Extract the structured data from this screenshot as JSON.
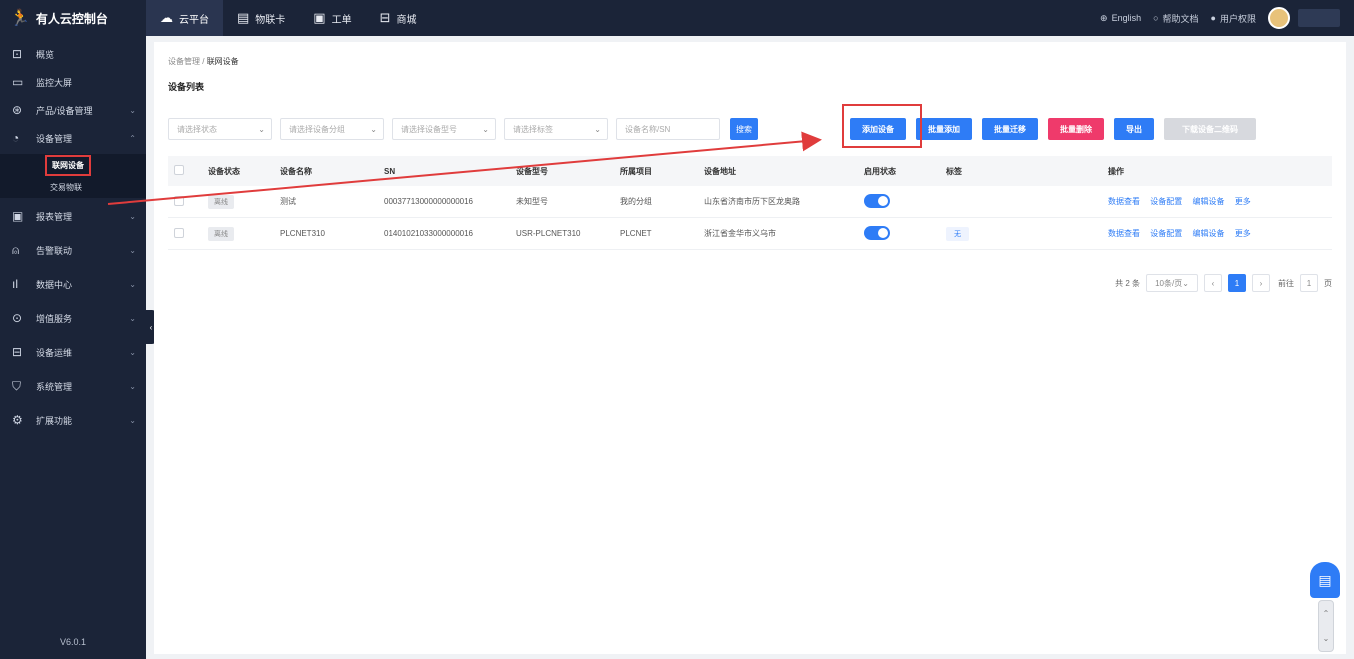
{
  "brand": {
    "name": "有人云控制台",
    "logo_icon": "person-logo-icon"
  },
  "topnav": [
    {
      "label": "云平台",
      "icon": "cloud-icon",
      "active": true
    },
    {
      "label": "物联卡",
      "icon": "card-icon",
      "active": false
    },
    {
      "label": "工单",
      "icon": "ticket-icon",
      "active": false
    },
    {
      "label": "商城",
      "icon": "store-icon",
      "active": false
    }
  ],
  "topright": {
    "language": "English",
    "help": "帮助文档",
    "user_center": "用户权限"
  },
  "sidebar": {
    "items": [
      {
        "label": "概览",
        "icon": "dashboard-icon"
      },
      {
        "label": "监控大屏",
        "icon": "monitor-icon"
      },
      {
        "label": "产品/设备管理",
        "icon": "product-icon"
      },
      {
        "label": "设备管理",
        "icon": "device-icon"
      }
    ],
    "sub_items": [
      {
        "label": "联网设备",
        "active": true
      },
      {
        "label": "交易物联",
        "active": false
      }
    ],
    "items_after": [
      {
        "label": "报表管理",
        "icon": "report-icon"
      },
      {
        "label": "告警联动",
        "icon": "alarm-icon"
      },
      {
        "label": "数据中心",
        "icon": "data-icon"
      },
      {
        "label": "增值服务",
        "icon": "service-icon"
      },
      {
        "label": "设备运维",
        "icon": "ops-icon"
      },
      {
        "label": "系统管理",
        "icon": "shield-icon"
      },
      {
        "label": "扩展功能",
        "icon": "gear-icon"
      }
    ],
    "version": "V6.0.1"
  },
  "main": {
    "breadcrumb": {
      "parent": "设备管理",
      "current": "联网设备"
    },
    "title": "设备列表",
    "filters": [
      {
        "placeholder": "请选择状态"
      },
      {
        "placeholder": "请选择设备分组"
      },
      {
        "placeholder": "请选择设备型号"
      },
      {
        "placeholder": "请选择标签"
      },
      {
        "placeholder": "设备名称/SN"
      }
    ],
    "search_label": "搜索",
    "actions": [
      {
        "label": "添加设备",
        "style": "blue"
      },
      {
        "label": "批量添加",
        "style": "blue"
      },
      {
        "label": "批量迁移",
        "style": "blue"
      },
      {
        "label": "批量删除",
        "style": "red"
      },
      {
        "label": "导出",
        "style": "blue"
      },
      {
        "label": "下载设备二维码",
        "style": "disabled"
      }
    ],
    "table": {
      "headers": [
        "",
        "设备状态",
        "设备名称",
        "SN",
        "设备型号",
        "所属项目",
        "设备地址",
        "启用状态",
        "标签",
        "操作"
      ],
      "rows": [
        {
          "status": "离线",
          "name": "测试",
          "sn": "00037713000000000016",
          "model": "未知型号",
          "group": "我的分组",
          "address": "山东省济南市历下区龙奥路",
          "enabled": true,
          "tag": "",
          "ops": [
            "数据查看",
            "设备配置",
            "编辑设备",
            "更多"
          ]
        },
        {
          "status": "离线",
          "name": "PLCNET310",
          "sn": "01401021033000000016",
          "model": "USR-PLCNET310",
          "group": "PLCNET",
          "address": "浙江省金华市义乌市",
          "enabled": true,
          "tag": "无",
          "ops": [
            "数据查看",
            "设备配置",
            "编辑设备",
            "更多"
          ]
        }
      ]
    },
    "pager": {
      "total": "共 2 条",
      "size": "10条/页",
      "current": "1",
      "goto": "前往",
      "goto_value": "1",
      "page_unit": "页"
    }
  }
}
